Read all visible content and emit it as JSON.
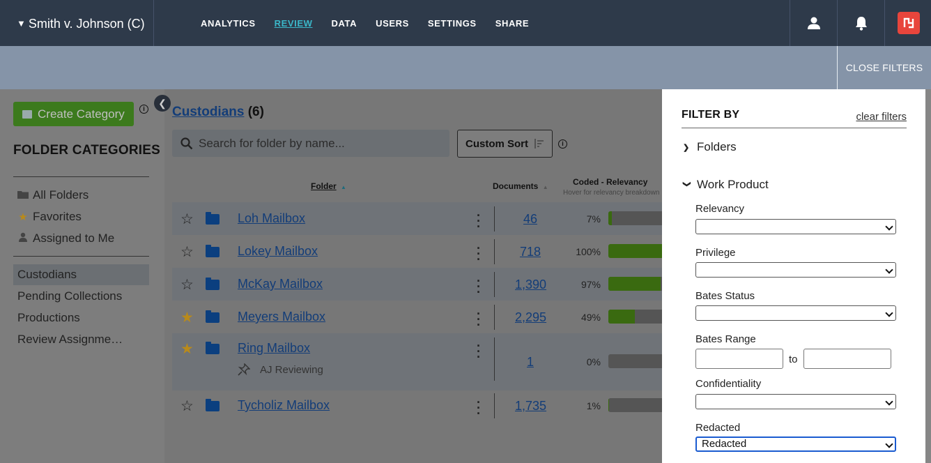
{
  "app": {
    "case_title": "Smith v. Johnson (C)",
    "nav": [
      "ANALYTICS",
      "REVIEW",
      "DATA",
      "USERS",
      "SETTINGS",
      "SHARE"
    ],
    "active_nav": "REVIEW",
    "icons": [
      "user-icon",
      "bell-icon",
      "brand-logo"
    ],
    "accent_color": "#3bb7c9",
    "logo_color": "#e8453c"
  },
  "filterbar": {
    "close_label": "CLOSE FILTERS"
  },
  "left": {
    "create_label": "Create Category",
    "section_title": "FOLDER CATEGORIES",
    "quick": [
      {
        "label": "All Folders",
        "icon": "folder-icon"
      },
      {
        "label": "Favorites",
        "icon": "star-icon"
      },
      {
        "label": "Assigned to Me",
        "icon": "person-icon"
      }
    ],
    "categories": [
      "Custodians",
      "Pending Collections",
      "Productions",
      "Review Assignme…"
    ],
    "selected_category": "Custodians"
  },
  "main": {
    "crumb": "Custodians",
    "count": "(6)",
    "search_placeholder": "Search for folder by name...",
    "sort_label": "Custom Sort",
    "col_folder": "Folder",
    "col_documents": "Documents",
    "col_coded": "Coded - Relevancy",
    "col_coded_sub": "Hover for relevancy breakdown",
    "rows": [
      {
        "name": "Loh Mailbox",
        "docs": "46",
        "pct": "7%",
        "pct_value": 7,
        "starred": false
      },
      {
        "name": "Lokey Mailbox",
        "docs": "718",
        "pct": "100%",
        "pct_value": 100,
        "starred": false
      },
      {
        "name": "McKay Mailbox",
        "docs": "1,390",
        "pct": "97%",
        "pct_value": 97,
        "starred": false
      },
      {
        "name": "Meyers Mailbox",
        "docs": "2,295",
        "pct": "49%",
        "pct_value": 49,
        "starred": true
      },
      {
        "name": "Ring Mailbox",
        "docs": "1",
        "pct": "0%",
        "pct_value": 0,
        "starred": true,
        "note": "AJ Reviewing"
      },
      {
        "name": "Tycholiz Mailbox",
        "docs": "1,735",
        "pct": "1%",
        "pct_value": 1,
        "starred": false
      }
    ]
  },
  "filters": {
    "title": "FILTER BY",
    "clear": "clear filters",
    "folders_label": "Folders",
    "work_product_label": "Work Product",
    "relevancy_label": "Relevancy",
    "relevancy_value": "",
    "privilege_label": "Privilege",
    "privilege_value": "",
    "bates_status_label": "Bates Status",
    "bates_status_value": "",
    "bates_range_label": "Bates Range",
    "bates_range_to": "to",
    "confidentiality_label": "Confidentiality",
    "confidentiality_value": "",
    "redacted_label": "Redacted",
    "redacted_value": "Redacted"
  }
}
